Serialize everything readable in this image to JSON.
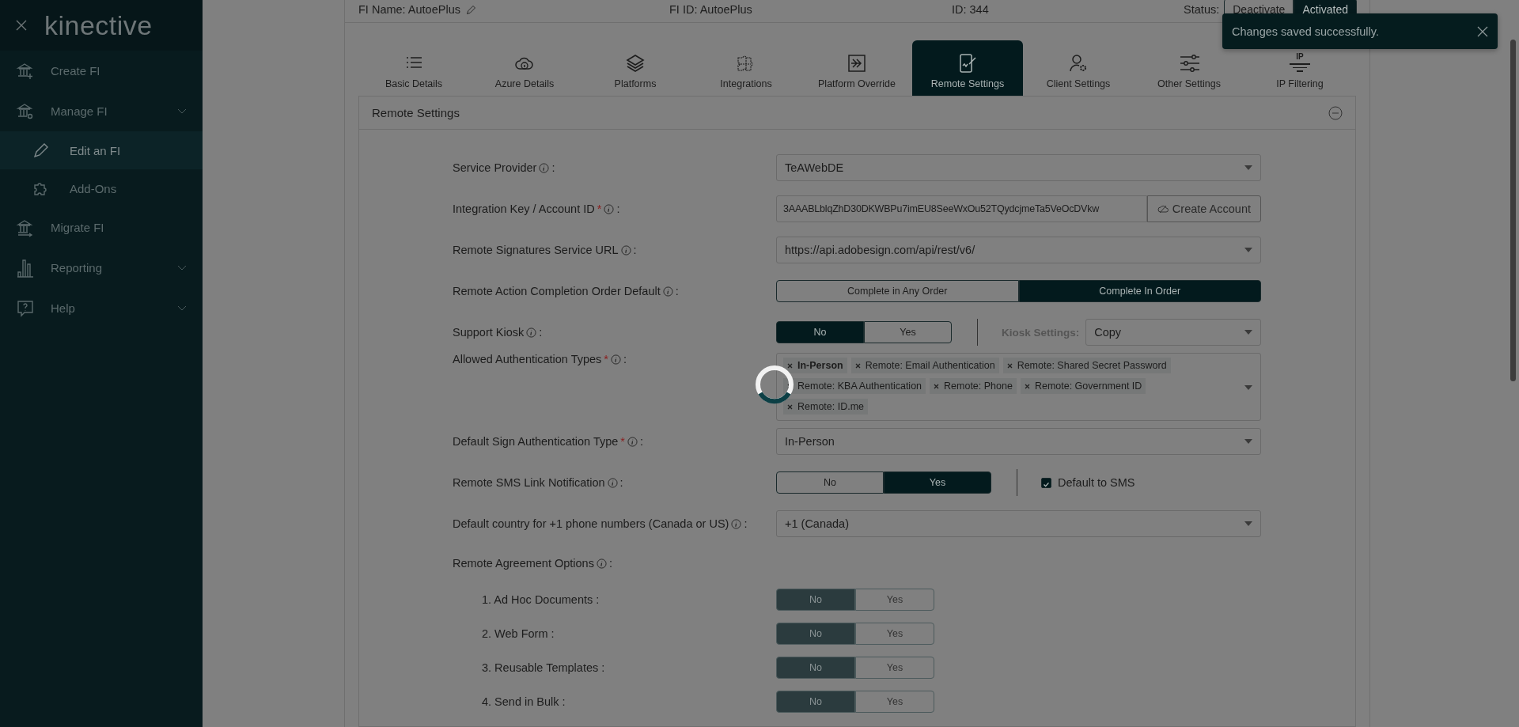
{
  "sidebar": {
    "brand": "kinective",
    "items": [
      {
        "kind": "link",
        "label": "Create FI",
        "selected": false
      },
      {
        "kind": "group",
        "label": "Manage FI",
        "selected": false,
        "children": [
          {
            "label": "Edit an FI",
            "selected": true
          },
          {
            "label": "Add-Ons",
            "selected": false
          }
        ]
      },
      {
        "kind": "link",
        "label": "Migrate FI",
        "selected": false
      },
      {
        "kind": "group",
        "label": "Reporting",
        "selected": false
      },
      {
        "kind": "group",
        "label": "Help",
        "selected": false
      }
    ]
  },
  "header": {
    "fi_name": "FI Name: AutoePlus",
    "fi_id": "FI ID: AutoePlus",
    "id": "ID: 344",
    "status_label": "Status:",
    "status_options": [
      {
        "label": "Deactivate",
        "selected": false
      },
      {
        "label": "Activated",
        "selected": true
      }
    ]
  },
  "tabs": [
    {
      "label": "Basic Details",
      "selected": false
    },
    {
      "label": "Azure Details",
      "selected": false
    },
    {
      "label": "Platforms",
      "selected": false
    },
    {
      "label": "Integrations",
      "selected": false
    },
    {
      "label": "Platform Override",
      "selected": false
    },
    {
      "label": "Remote Settings",
      "selected": true
    },
    {
      "label": "Client Settings",
      "selected": false
    },
    {
      "label": "Other Settings",
      "selected": false
    },
    {
      "label": "IP Filtering",
      "icon_text": "IP",
      "selected": false
    }
  ],
  "section": {
    "title": "Remote Settings",
    "fields": [
      {
        "kind": "select",
        "label": "Service Provider",
        "suffix": ":",
        "value": "TeAWebDE"
      },
      {
        "kind": "input_button",
        "label": "Integration Key / Account ID",
        "required_mark": "*",
        "suffix": ":",
        "value": "3AAABLblqZhD30DKWBPu7imEU8SeeWxOu52TQydcjmeTa5VeOcDVkw",
        "button": "Create Account"
      },
      {
        "kind": "select",
        "label": "Remote Signatures Service URL",
        "suffix": ":",
        "value": "https://api.adobesign.com/api/rest/v6/"
      },
      {
        "kind": "segmented",
        "label": "Remote Action Completion Order Default",
        "suffix": ":",
        "options": [
          {
            "label": "Complete in Any Order",
            "selected": false
          },
          {
            "label": "Complete In Order",
            "selected": true
          }
        ]
      },
      {
        "kind": "toggle_select",
        "label": "Support Kiosk",
        "suffix": ":",
        "options": [
          {
            "label": "No",
            "selected": true
          },
          {
            "label": "Yes",
            "selected": false
          }
        ],
        "side_label": "Kiosk Settings:",
        "side_value": "Copy"
      },
      {
        "kind": "tags",
        "label": "Allowed Authentication Types",
        "required_mark": "*",
        "suffix": ":",
        "tags": [
          {
            "label": "In-Person",
            "bold": true
          },
          {
            "label": "Remote: Email Authentication",
            "bold": false
          },
          {
            "label": "Remote: Shared Secret Password",
            "bold": false
          },
          {
            "label": "Remote: KBA Authentication",
            "bold": false
          },
          {
            "label": "Remote: Phone",
            "bold": false
          },
          {
            "label": "Remote: Government ID",
            "bold": false
          },
          {
            "label": "Remote: ID.me",
            "bold": false
          }
        ]
      },
      {
        "kind": "select",
        "label": "Default Sign Authentication Type",
        "required_mark": "*",
        "suffix": ":",
        "value": "In-Person"
      },
      {
        "kind": "toggle_check",
        "label": "Remote SMS Link Notification",
        "suffix": ":",
        "options": [
          {
            "label": "No",
            "selected": false
          },
          {
            "label": "Yes",
            "selected": true
          }
        ],
        "checkbox": {
          "label": "Default to SMS",
          "checked": true
        }
      },
      {
        "kind": "select",
        "label": "Default country for +1 phone numbers (Canada or US)",
        "suffix": ":",
        "value": "+1 (Canada)"
      },
      {
        "kind": "heading",
        "label": "Remote Agreement Options",
        "suffix": ":"
      },
      {
        "kind": "sub_toggle",
        "label": "1. Ad Hoc Documents :",
        "disabled": true,
        "options": [
          {
            "label": "No",
            "selected": true
          },
          {
            "label": "Yes",
            "selected": false
          }
        ]
      },
      {
        "kind": "sub_toggle",
        "label": "2. Web Form :",
        "disabled": true,
        "options": [
          {
            "label": "No",
            "selected": true
          },
          {
            "label": "Yes",
            "selected": false
          }
        ]
      },
      {
        "kind": "sub_toggle",
        "label": "3. Reusable Templates :",
        "disabled": true,
        "options": [
          {
            "label": "No",
            "selected": true
          },
          {
            "label": "Yes",
            "selected": false
          }
        ]
      },
      {
        "kind": "sub_toggle",
        "label": "4. Send in Bulk :",
        "disabled": true,
        "options": [
          {
            "label": "No",
            "selected": true
          },
          {
            "label": "Yes",
            "selected": false
          }
        ]
      }
    ]
  },
  "toast": {
    "message": "Changes saved successfully."
  }
}
